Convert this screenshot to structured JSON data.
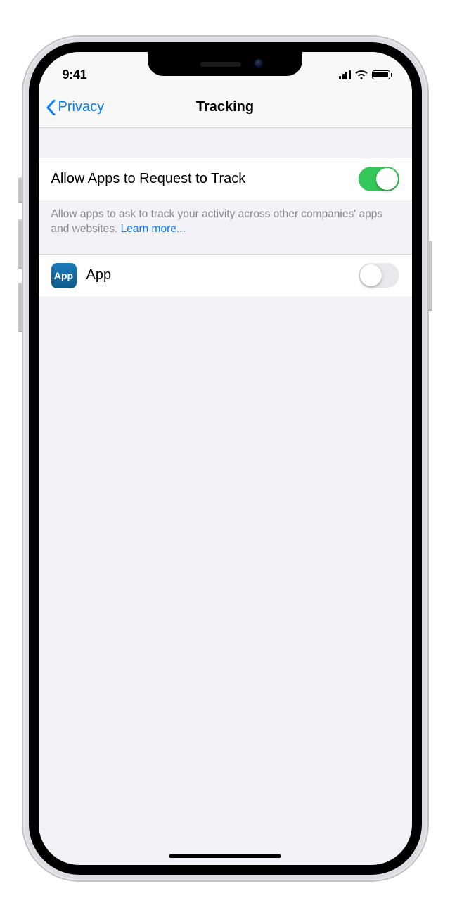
{
  "status": {
    "time": "9:41"
  },
  "nav": {
    "back_label": "Privacy",
    "title": "Tracking"
  },
  "tracking": {
    "master_label": "Allow Apps to Request to Track",
    "footer_text": "Allow apps to ask to track your activity across other companies' apps and websites. ",
    "learn_more": "Learn more...",
    "app_icon_text": "App",
    "app_name": "App"
  }
}
